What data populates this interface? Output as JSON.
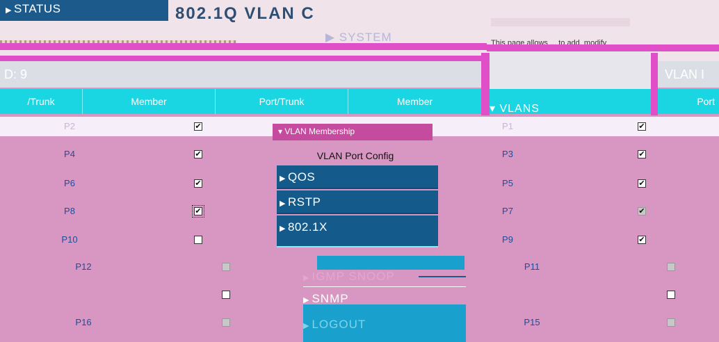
{
  "status_tab": "STATUS",
  "title_fragment": "802.1Q VLAN C",
  "system_ghost": "SYSTEM",
  "description_fragment": "This page allows ... to add, modify",
  "vlan_id_label": "D: 9",
  "vlan_id_right": "VLAN I",
  "headers": [
    "/Trunk",
    "Member",
    "Port/Trunk",
    "Member",
    "Port"
  ],
  "vlans_label": "VLANS",
  "rows_left": [
    {
      "port": "P2",
      "checked": true,
      "style": "faint"
    },
    {
      "port": "P4",
      "checked": true
    },
    {
      "port": "P6",
      "checked": true
    },
    {
      "port": "P8",
      "checked": true,
      "focused": true
    },
    {
      "port": "P10",
      "checked": false
    },
    {
      "port": "P12",
      "checked": false,
      "style": "grey"
    },
    {
      "port": "",
      "checked": false
    },
    {
      "port": "P16",
      "checked": false,
      "style": "grey"
    }
  ],
  "rows_right": [
    {
      "port": "P1",
      "checked": true,
      "style": "faint"
    },
    {
      "port": "P3",
      "checked": true
    },
    {
      "port": "P5",
      "checked": true
    },
    {
      "port": "P7",
      "checked": true,
      "style": "grey"
    },
    {
      "port": "P9",
      "checked": true
    },
    {
      "port": "P11",
      "checked": false,
      "style": "grey"
    },
    {
      "port": "",
      "checked": false
    },
    {
      "port": "P15",
      "checked": false,
      "style": "grey"
    }
  ],
  "menu": {
    "vlan_item": "VLAN Membership",
    "vlan_port_config": "VLAN Port Config",
    "items": [
      "QOS",
      "RSTP",
      "802.1X"
    ],
    "igmp": "IGMP SNOOP",
    "snmp": "SNMP",
    "logout": "LOGOUT"
  },
  "check_glyph": "✔"
}
